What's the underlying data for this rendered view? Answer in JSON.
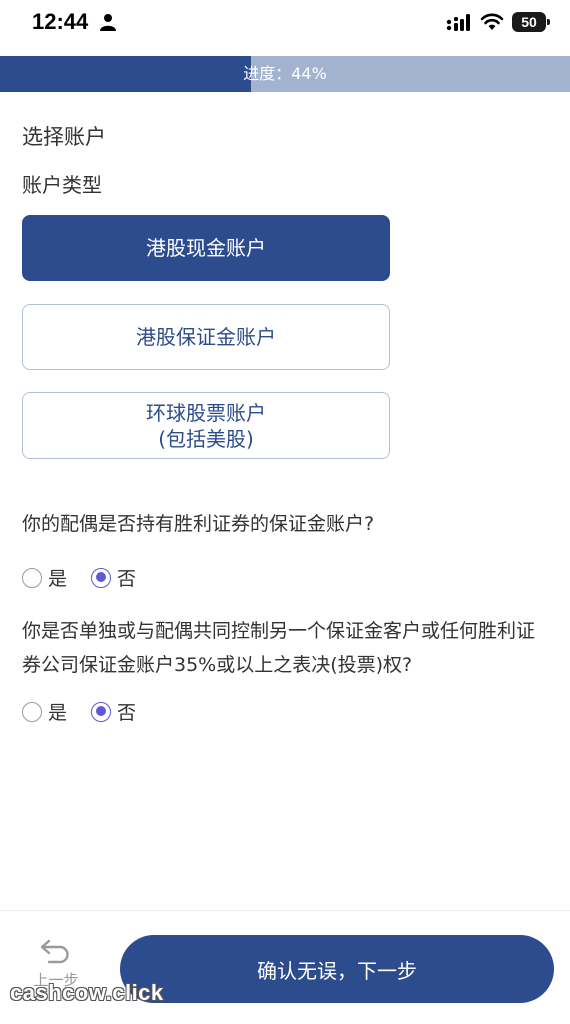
{
  "status_bar": {
    "time": "12:44",
    "battery": "50",
    "icons": [
      "person-icon",
      "signal-icon",
      "wifi-icon",
      "battery-icon"
    ]
  },
  "progress": {
    "label": "进度：44%",
    "value": 0.44
  },
  "page": {
    "section_title": "选择账户",
    "account_type_label": "账户类型"
  },
  "account_types": [
    {
      "lines": [
        "港股现金账户"
      ],
      "selected": true
    },
    {
      "lines": [
        "港股保证金账户"
      ],
      "selected": false
    },
    {
      "lines": [
        "环球股票账户",
        "(包括美股)"
      ],
      "selected": false
    }
  ],
  "questions": [
    {
      "text": "你的配偶是否持有胜利证券的保证金账户?",
      "options": [
        "是",
        "否"
      ],
      "selected": "否"
    },
    {
      "text": "你是否单独或与配偶共同控制另一个保证金客户或任何胜利证券公司保证金账户35%或以上之表决(投票)权?",
      "options": [
        "是",
        "否"
      ],
      "selected": "否"
    }
  ],
  "footer": {
    "back_label": "上一步",
    "next_label": "确认无误，下一步"
  },
  "watermark": "cashcow.click",
  "colors": {
    "primary": "#2d4c8d",
    "progress_track": "#a3b3cf",
    "radio_checked": "#5b5bd6"
  }
}
